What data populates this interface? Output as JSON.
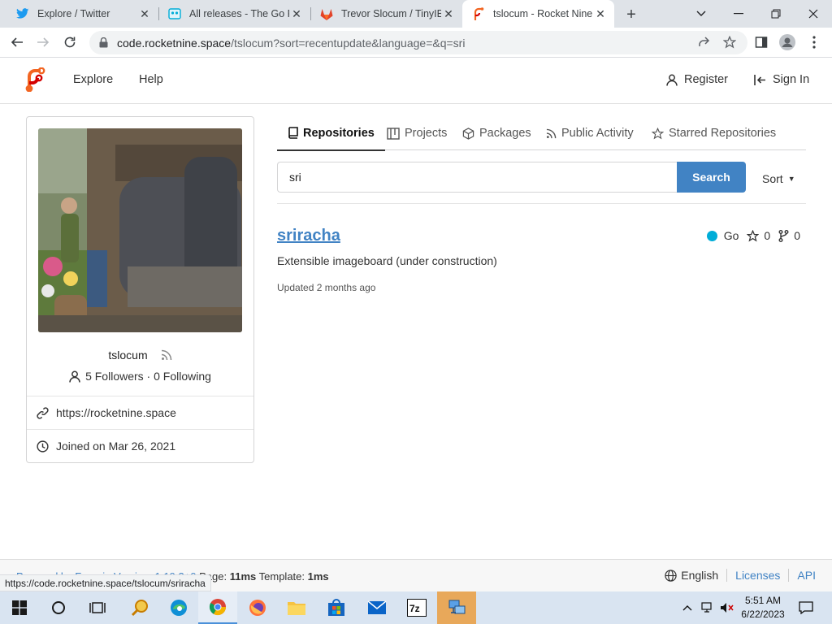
{
  "browser": {
    "tabs": [
      {
        "title": "Explore / Twitter",
        "icon": "twitter-icon"
      },
      {
        "title": "All releases - The Go Pr",
        "icon": "go-icon"
      },
      {
        "title": "Trevor Slocum / TinyIB",
        "icon": "gitlab-icon"
      },
      {
        "title": "tslocum - Rocket Nine",
        "icon": "forgejo-icon"
      }
    ],
    "url_host": "code.rocketnine.space",
    "url_path": "/tslocum?sort=recentupdate&language=&q=sri"
  },
  "header": {
    "explore": "Explore",
    "help": "Help",
    "register": "Register",
    "sign_in": "Sign In"
  },
  "profile": {
    "username": "tslocum",
    "followers_text": "5 Followers · 0 Following",
    "website": "https://rocketnine.space",
    "joined": "Joined on Mar 26, 2021"
  },
  "tabs": {
    "repositories": "Repositories",
    "projects": "Projects",
    "packages": "Packages",
    "public_activity": "Public Activity",
    "starred": "Starred Repositories"
  },
  "search": {
    "value": "sri",
    "button": "Search",
    "sort": "Sort"
  },
  "repo": {
    "name": "sriracha",
    "description": "Extensible imageboard (under construction)",
    "updated": "Updated 2 months ago",
    "language": "Go",
    "language_color": "#00add8",
    "stars": "0",
    "forks": "0"
  },
  "footer": {
    "powered_prefix": "Powered by Forgejo Version: 1.19.3+0 ",
    "page_label": "Page: ",
    "page_time": "11ms",
    "template_label": " Template: ",
    "template_time": "1ms",
    "language": "English",
    "licenses": "Licenses",
    "api": "API"
  },
  "statusbar": {
    "url": "https://code.rocketnine.space/tslocum/sriracha"
  },
  "taskbar": {
    "time": "5:51 AM",
    "date": "6/22/2023"
  },
  "colors": {
    "link": "#4183c4",
    "search_button": "#4183c4"
  }
}
